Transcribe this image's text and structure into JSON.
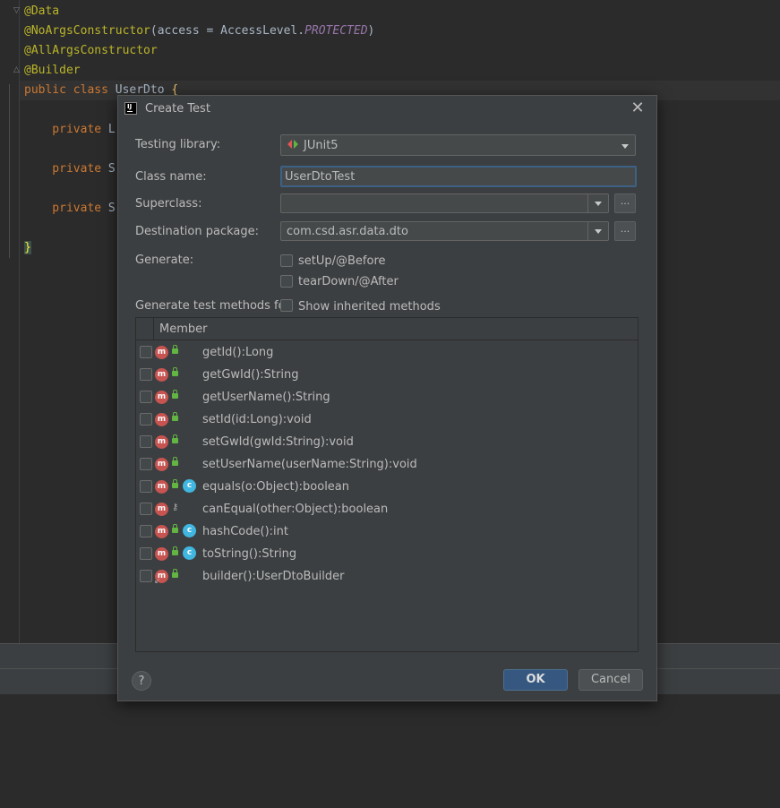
{
  "editor": {
    "lines": [
      {
        "parts": [
          {
            "t": "@Data",
            "c": "ann"
          }
        ]
      },
      {
        "parts": [
          {
            "t": "@NoArgsConstructor",
            "c": "ann"
          },
          {
            "t": "(access = AccessLevel.",
            "c": ""
          },
          {
            "t": "PROTECTED",
            "c": "it"
          },
          {
            "t": ")",
            "c": ""
          }
        ]
      },
      {
        "parts": [
          {
            "t": "@AllArgsConstructor",
            "c": "ann"
          }
        ]
      },
      {
        "parts": [
          {
            "t": "@Builder",
            "c": "ann"
          }
        ]
      },
      {
        "parts": [
          {
            "t": "public class ",
            "c": "kw"
          },
          {
            "t": "UserDto ",
            "c": ""
          },
          {
            "t": "{",
            "c": "brace-y"
          }
        ]
      },
      {
        "parts": [
          {
            "t": "",
            "c": ""
          }
        ]
      },
      {
        "parts": [
          {
            "t": "    private ",
            "c": "kw"
          },
          {
            "t": "L",
            "c": ""
          }
        ]
      },
      {
        "parts": [
          {
            "t": "",
            "c": ""
          }
        ]
      },
      {
        "parts": [
          {
            "t": "    private ",
            "c": "kw"
          },
          {
            "t": "S",
            "c": ""
          }
        ]
      },
      {
        "parts": [
          {
            "t": "",
            "c": ""
          }
        ]
      },
      {
        "parts": [
          {
            "t": "    private ",
            "c": "kw"
          },
          {
            "t": "S",
            "c": ""
          }
        ]
      },
      {
        "parts": [
          {
            "t": "",
            "c": ""
          }
        ]
      },
      {
        "parts": [
          {
            "t": "}",
            "c": "brace-hl"
          }
        ]
      }
    ]
  },
  "dialog": {
    "title": "Create Test",
    "close_glyph": "✕",
    "testing_library": {
      "label": "Testing library:",
      "value": "JUnit5"
    },
    "class_name": {
      "label": "Class name:",
      "value": "UserDtoTest"
    },
    "superclass": {
      "label": "Superclass:",
      "value": "",
      "browse": "..."
    },
    "destination_package": {
      "label": "Destination package:",
      "value": "com.csd.asr.data.dto",
      "browse": "..."
    },
    "generate": {
      "label": "Generate:",
      "options": [
        "setUp/@Before",
        "tearDown/@After"
      ]
    },
    "generate_for": {
      "label": "Generate test methods for:",
      "show_inherited": "Show inherited methods"
    },
    "members": {
      "header": "Member",
      "rows": [
        {
          "name": "getId():Long",
          "access": "public",
          "override": false
        },
        {
          "name": "getGwId():String",
          "access": "public",
          "override": false
        },
        {
          "name": "getUserName():String",
          "access": "public",
          "override": false
        },
        {
          "name": "setId(id:Long):void",
          "access": "public",
          "override": false
        },
        {
          "name": "setGwId(gwId:String):void",
          "access": "public",
          "override": false
        },
        {
          "name": "setUserName(userName:String):void",
          "access": "public",
          "override": false
        },
        {
          "name": "equals(o:Object):boolean",
          "access": "public",
          "override": true
        },
        {
          "name": "canEqual(other:Object):boolean",
          "access": "protected",
          "override": false
        },
        {
          "name": "hashCode():int",
          "access": "public",
          "override": true
        },
        {
          "name": "toString():String",
          "access": "public",
          "override": true
        },
        {
          "name": "builder():UserDtoBuilder",
          "access": "public",
          "override": false,
          "static": true
        }
      ]
    },
    "help": "?",
    "ok": "OK",
    "cancel": "Cancel"
  },
  "colors": {
    "editor_bg": "#2b2b2b",
    "dialog_bg": "#3c3f41",
    "accent_blue": "#365880",
    "method_icon": "#c75450",
    "override_icon": "#40b6e0",
    "lock_green": "#62b543"
  },
  "icons": {
    "app": "intellij-idea-icon",
    "close": "close-icon",
    "junit": "junit-icon",
    "dropdown": "chevron-down-icon",
    "method": "method-icon",
    "public": "lock-open-icon",
    "override": "override-icon",
    "help": "help-icon"
  }
}
